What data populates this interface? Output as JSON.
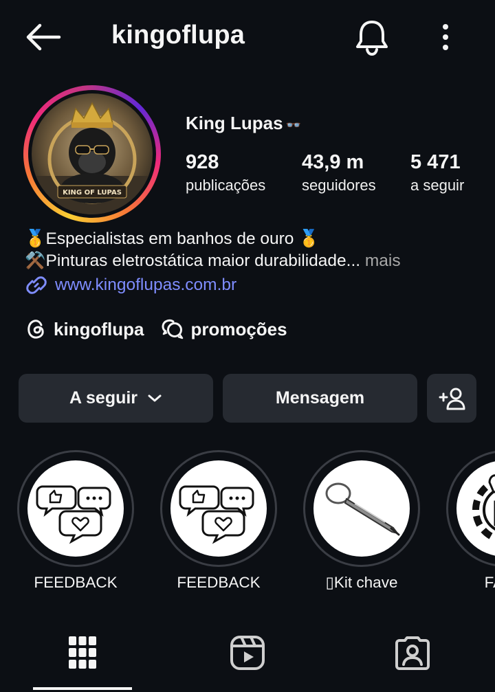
{
  "header": {
    "username": "kingoflupa",
    "back_icon": "arrow-left-icon",
    "notification_icon": "bell-icon",
    "more_icon": "more-vertical-icon"
  },
  "profile": {
    "avatar_text": "KING OF LUPAS",
    "display_name": "King Lupas",
    "name_emoji": "👓",
    "stats": [
      {
        "value": "928",
        "label": "publicações"
      },
      {
        "value": "43,9 m",
        "label": "seguidores"
      },
      {
        "value": "5 471",
        "label": "a seguir"
      }
    ],
    "bio": {
      "line1": "🥇Especialistas em banhos de ouro 🥇",
      "line2": "⚒️Pinturas eletrostática maior durabilidade...",
      "more": "mais",
      "link": "www.kingoflupas.com.br"
    },
    "chips": [
      {
        "icon": "threads-icon",
        "label": "kingoflupa"
      },
      {
        "icon": "chat-bubbles-icon",
        "label": "promoções"
      }
    ]
  },
  "actions": {
    "follow_label": "A seguir",
    "message_label": "Mensagem",
    "add_user_icon": "add-person-icon"
  },
  "highlights": [
    {
      "label": "FEEDBACK",
      "icon": "feedback-bubbles-icon"
    },
    {
      "label": "FEEDBACK",
      "icon": "feedback-bubbles-icon"
    },
    {
      "label": "▯Kit chave",
      "icon": "keychain-screwdriver-icon"
    },
    {
      "label": "FABR",
      "icon": "gear-icon"
    }
  ],
  "tabs": [
    {
      "name": "grid",
      "icon": "grid-icon",
      "active": true
    },
    {
      "name": "reels",
      "icon": "reels-icon",
      "active": false
    },
    {
      "name": "tagged",
      "icon": "tagged-person-icon",
      "active": false
    }
  ],
  "colors": {
    "background": "#0c0f14",
    "button": "#262a31",
    "link": "#7f8dff",
    "muted": "#a8a8a8"
  }
}
